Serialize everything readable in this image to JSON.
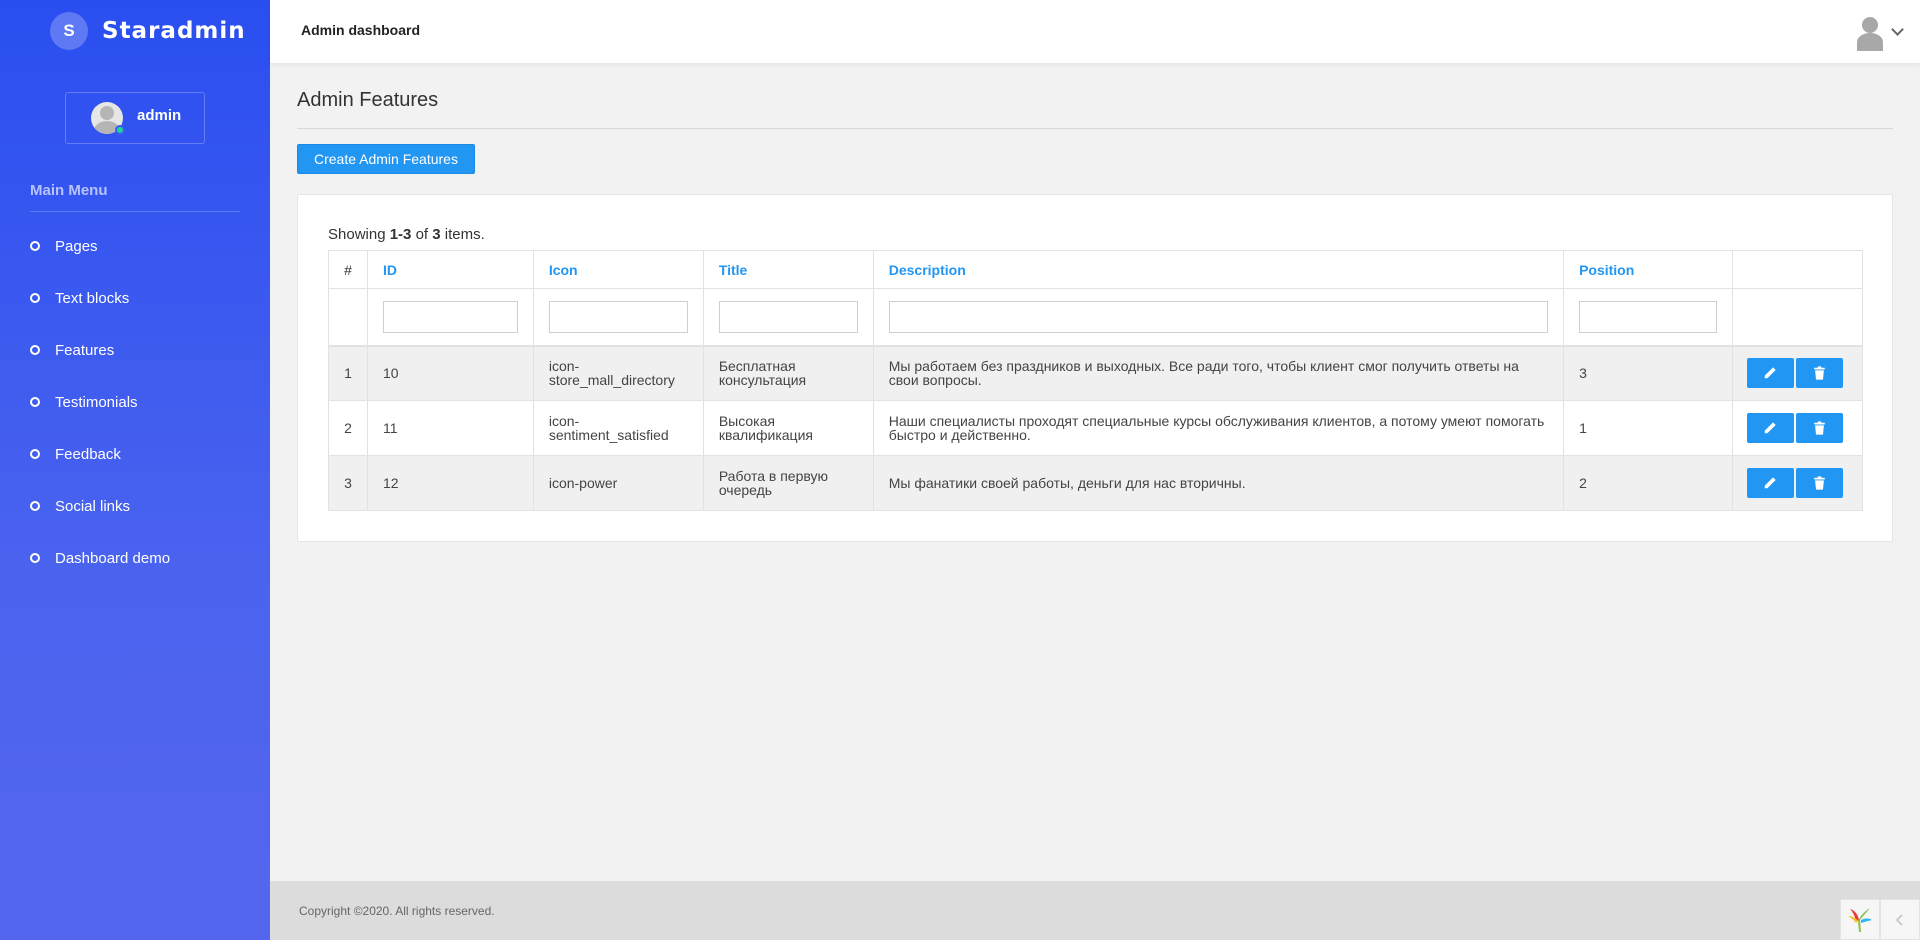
{
  "brand": {
    "logo_letter": "S",
    "name": "Staradmin"
  },
  "user": {
    "name": "admin"
  },
  "sidebar": {
    "menu_title": "Main Menu",
    "items": [
      {
        "label": "Pages"
      },
      {
        "label": "Text blocks"
      },
      {
        "label": "Features"
      },
      {
        "label": "Testimonials"
      },
      {
        "label": "Feedback"
      },
      {
        "label": "Social links"
      },
      {
        "label": "Dashboard demo"
      }
    ]
  },
  "header": {
    "title": "Admin dashboard"
  },
  "page": {
    "title": "Admin Features",
    "create_button": "Create Admin Features",
    "summary": {
      "prefix": "Showing ",
      "range": "1-3",
      "middle": " of ",
      "total": "3",
      "suffix": " items."
    }
  },
  "table": {
    "columns": {
      "hash": "#",
      "id": "ID",
      "icon": "Icon",
      "title": "Title",
      "description": "Description",
      "position": "Position"
    },
    "rows": [
      {
        "num": "1",
        "id": "10",
        "icon": "icon-store_mall_directory",
        "title": "Бесплатная консультация",
        "description": "Мы работаем без праздников и выходных. Все ради того, чтобы клиент смог получить ответы на свои вопросы.",
        "position": "3"
      },
      {
        "num": "2",
        "id": "11",
        "icon": "icon-sentiment_satisfied",
        "title": "Высокая квалификация",
        "description": "Наши специалисты проходят специальные курсы обслуживания клиентов, а потому умеют помогать быстро и действенно.",
        "position": "1"
      },
      {
        "num": "3",
        "id": "12",
        "icon": "icon-power",
        "title": "Работа в первую очередь",
        "description": "Мы фанатики своей работы, деньги для нас вторичны.",
        "position": "2"
      }
    ]
  },
  "footer": {
    "copyright": "Copyright ©2020. All rights reserved."
  },
  "colors": {
    "accent": "#2196f3",
    "sidebar": "#2a4ef0",
    "online": "#19d895"
  }
}
